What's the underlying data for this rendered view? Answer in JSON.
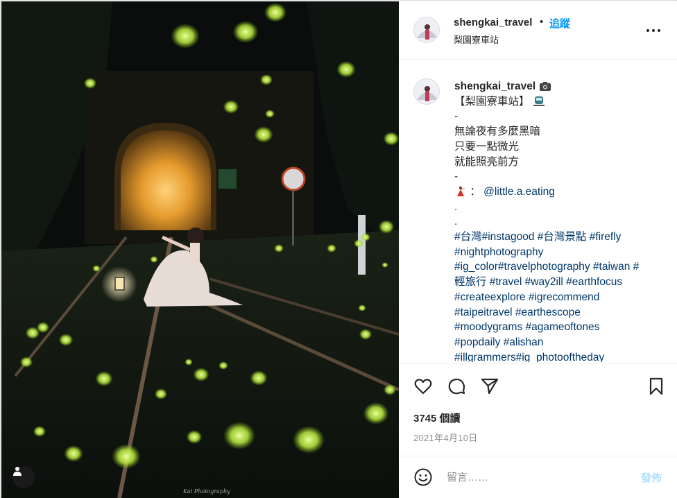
{
  "post": {
    "username": "shengkai_travel",
    "separator": "•",
    "follow_label": "追蹤",
    "location": "梨園寮車站",
    "more_icon": "more-horizontal-icon",
    "photo_watermark": "Kai Photography"
  },
  "caption": {
    "username": "shengkai_travel",
    "lines": [
      "【梨園寮車站】",
      "-",
      "無論夜有多麼黑暗",
      "只要一點微光",
      "就能照亮前方",
      "-"
    ],
    "mention_prefix": "：",
    "mention": "@little.a.eating",
    "dots": [
      ".",
      "."
    ],
    "hashtags": [
      "#台灣#instagood #台灣景點 #firefly",
      "#nightphotography",
      "#ig_color#travelphotography #taiwan #",
      "輕旅行 #travel #way2ill #earthfocus",
      "#createexplore #igrecommend",
      "#taipeitravel #earthescope",
      "#moodygrams #agameoftones",
      "#popdaily #alishan",
      "#illgrammers#ig_photooftheday"
    ]
  },
  "actions": {
    "like_icon": "heart-icon",
    "comment_icon": "comment-icon",
    "share_icon": "send-icon",
    "save_icon": "bookmark-icon",
    "views": "3745 個讀",
    "date": "2021年4月10日"
  },
  "comment_box": {
    "emoji_icon": "smiley-icon",
    "placeholder": "留言……",
    "post_label": "發佈"
  },
  "colors": {
    "link": "#00376b",
    "follow": "#0095f6",
    "post_disabled": "#b2dffc",
    "firefly": "#c8f25a"
  }
}
